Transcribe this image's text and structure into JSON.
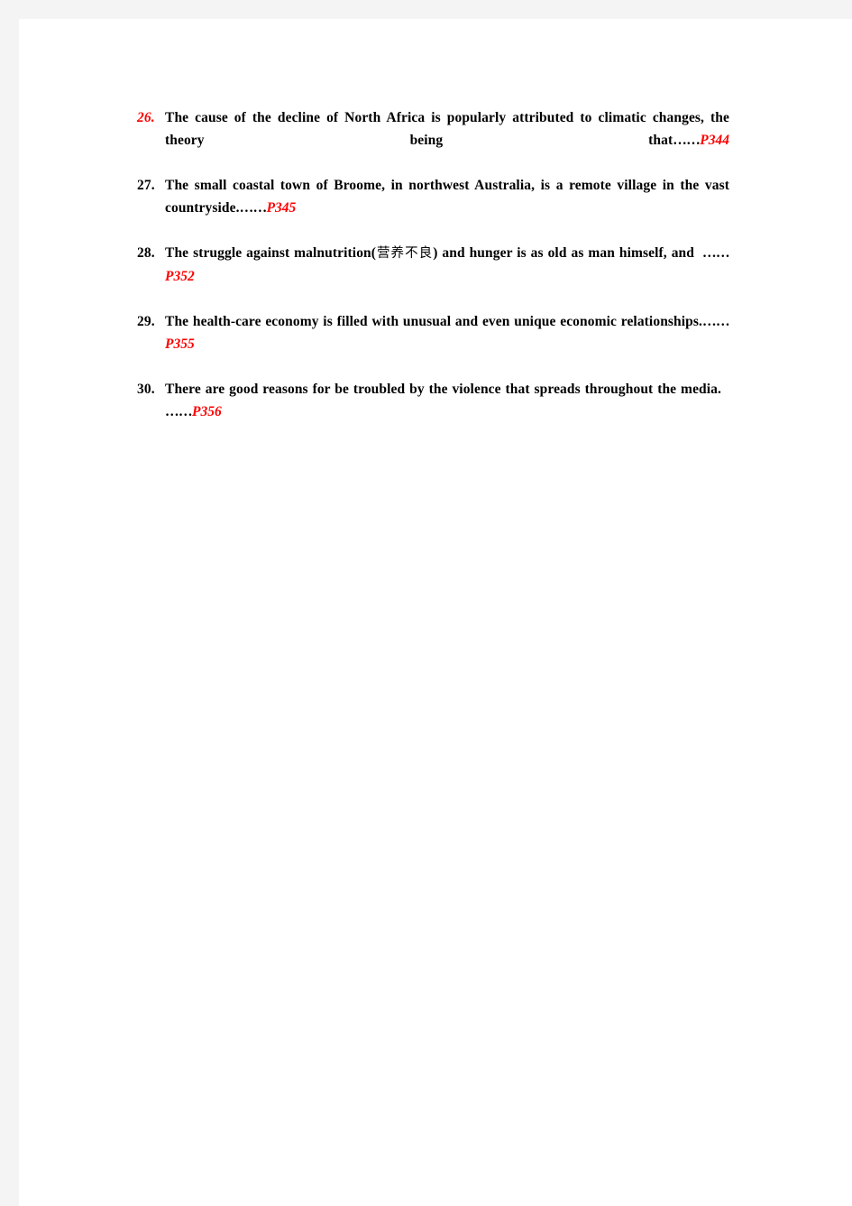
{
  "document": {
    "page_background": "#ffffff",
    "backdrop_color": "#f4f4f4",
    "accent_color": "#ff0000",
    "text_color": "#000000",
    "leader": "……",
    "questions": [
      {
        "number": "26.",
        "number_style": "accent",
        "text": "The cause of the decline of North Africa is popularly attributed to climatic changes, the theory being that",
        "leader": "……",
        "page_ref": "P344",
        "trailing_gap": false,
        "cjk": null
      },
      {
        "number": "27.",
        "number_style": "normal",
        "text": "The small coastal town of Broome, in northwest Australia, is a remote village in the vast countryside.",
        "leader": "……",
        "page_ref": "P345",
        "trailing_gap": false,
        "cjk": null
      },
      {
        "number": "28.",
        "number_style": "normal",
        "text_before_cjk": "The struggle against malnutrition(",
        "cjk": "营养不良",
        "text_after_cjk": ") and hunger is as old as man himself, and",
        "text": "The struggle against malnutrition(营养不良) and hunger is as old as man himself, and",
        "leader": "……",
        "page_ref": "P352",
        "trailing_gap": true
      },
      {
        "number": "29.",
        "number_style": "normal",
        "text": "The health-care economy is filled with unusual and even unique economic relationships.",
        "leader": "……",
        "page_ref": "P355",
        "trailing_gap": false,
        "cjk": null
      },
      {
        "number": "30.",
        "number_style": "normal",
        "text": "There are good reasons for be troubled by the violence that spreads throughout the media.",
        "leader": "……",
        "page_ref": "P356",
        "trailing_gap": true,
        "cjk": null
      }
    ]
  }
}
